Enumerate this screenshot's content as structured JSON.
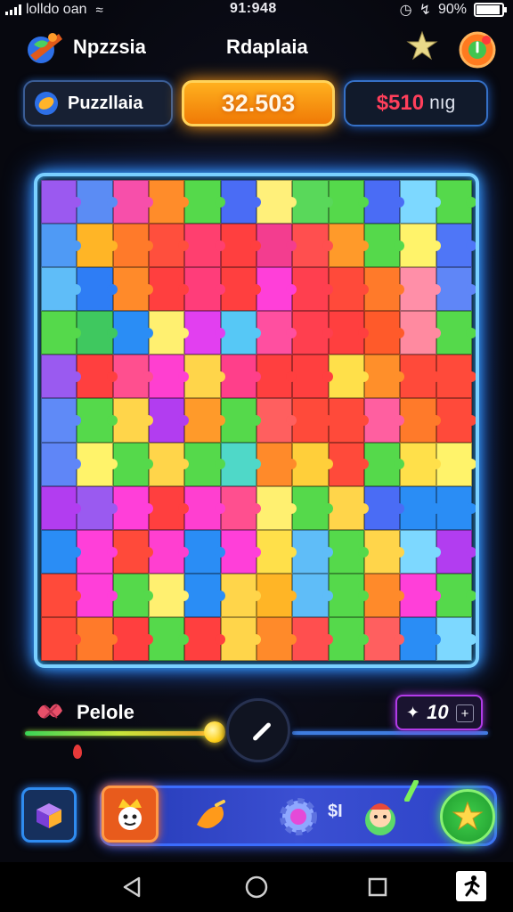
{
  "status_bar": {
    "carrier": "lolldo oan",
    "time": "91:948",
    "battery": "90%"
  },
  "header": {
    "app_name": "Npzzsia",
    "mode_title": "Rdaplaia"
  },
  "stats": {
    "left_label": "Puzzllaia",
    "score": "32.503",
    "money": "$510",
    "money_unit": "nıg"
  },
  "board": {
    "rows": 11,
    "cols": 12,
    "colors": [
      [
        "#9b59f0",
        "#5b8cf4",
        "#f74faa",
        "#ff8c2a",
        "#55d94b",
        "#4a6cf5",
        "#fff07a",
        "#59d85a",
        "#55d94b",
        "#4a6cf5",
        "#7dd8ff",
        "#55d94b"
      ],
      [
        "#4f9af5",
        "#ffb526",
        "#ff7a2a",
        "#ff4f3d",
        "#ff3f6f",
        "#ff3f3f",
        "#f33d8f",
        "#ff4f4f",
        "#ff9a2a",
        "#55d94b",
        "#fff36a",
        "#4f76f7"
      ],
      [
        "#5fbdf8",
        "#2e7df5",
        "#ff8a2a",
        "#ff3f3f",
        "#ff3d7a",
        "#ff3f3f",
        "#ff3fd9",
        "#ff3f4f",
        "#ff4a3a",
        "#ff7a2a",
        "#ff8fa8",
        "#5f86f7"
      ],
      [
        "#55d94b",
        "#3fc85f",
        "#2a8df5",
        "#fff070",
        "#e23ff0",
        "#56c8f6",
        "#ff4fa0",
        "#ff3f4f",
        "#ff3f3f",
        "#ff5a2a",
        "#ff8aa0",
        "#55d94b"
      ],
      [
        "#9a5af0",
        "#ff3f3f",
        "#ff4f8f",
        "#ff3fd0",
        "#ffd54a",
        "#ff3f8a",
        "#ff3f3f",
        "#ff3f3f",
        "#ffe04a",
        "#ff8f2a",
        "#ff4a3a",
        "#ff4a3a"
      ],
      [
        "#5f8af7",
        "#55d94b",
        "#ffd54a",
        "#b23df0",
        "#ff9a2a",
        "#55d94b",
        "#ff5f5f",
        "#ff4a3a",
        "#ff4a3a",
        "#ff5fa0",
        "#ff7a2a",
        "#ff4a3a"
      ],
      [
        "#5f86f7",
        "#fff36a",
        "#55d94b",
        "#ffd54a",
        "#55d94b",
        "#4fd8c8",
        "#ff8a2a",
        "#ffcf3a",
        "#ff4a3a",
        "#55d94b",
        "#ffe04a",
        "#fff36a"
      ],
      [
        "#b23df0",
        "#9a5af0",
        "#ff3fd9",
        "#ff3f3f",
        "#ff3fd0",
        "#ff4f8f",
        "#fff070",
        "#55d94b",
        "#ffd54a",
        "#4a6cf5",
        "#2a8df5",
        "#2a8df5"
      ],
      [
        "#2a8df5",
        "#ff3fd9",
        "#ff4a3a",
        "#ff3fd0",
        "#2a8df5",
        "#ff3fd9",
        "#ffe04a",
        "#5fbdf8",
        "#55d94b",
        "#ffd54a",
        "#7dd8ff",
        "#b23df0"
      ],
      [
        "#ff4a3a",
        "#ff3fd9",
        "#55d94b",
        "#fff070",
        "#2a8df5",
        "#ffd54a",
        "#ffb526",
        "#5fbdf8",
        "#55d94b",
        "#ff8a2a",
        "#ff3fd9",
        "#55d94b"
      ],
      [
        "#ff4a3a",
        "#ff7a2a",
        "#ff3f3f",
        "#55d94b",
        "#ff3f3f",
        "#ffd54a",
        "#ff8a2a",
        "#ff4f4f",
        "#55d94b",
        "#ff5f5f",
        "#2a8df5",
        "#7dd8ff"
      ]
    ]
  },
  "slider": {
    "label": "Pelole",
    "level": 0.41
  },
  "counter": {
    "value": "10",
    "plus": "+"
  },
  "toolbar": {
    "dollar_text": "$I"
  },
  "icons": {
    "signal": "signal-icon",
    "wifi": "wifi-icon",
    "battery": "battery-icon",
    "alarm": "alarm-icon",
    "bluetooth": "bluetooth-icon"
  }
}
